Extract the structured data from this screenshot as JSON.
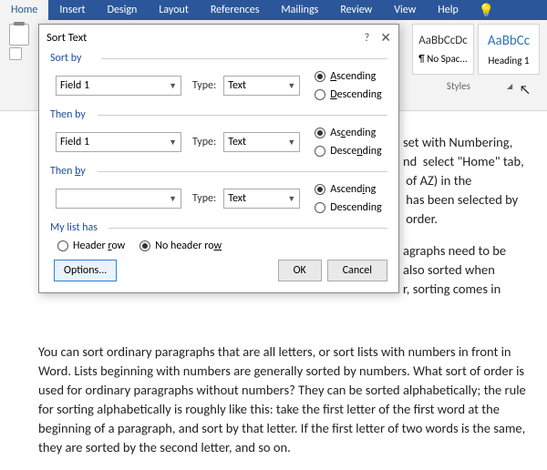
{
  "ribbon": {
    "tabs": [
      "Home",
      "Insert",
      "Design",
      "Layout",
      "References",
      "Mailings",
      "Review",
      "View",
      "Help"
    ],
    "active": "Home"
  },
  "styles": {
    "box1": {
      "preview": "AaBbCcDc",
      "name": "¶ No Spac..."
    },
    "box2": {
      "preview": "AaBbCc",
      "name": "Heading 1"
    },
    "group_label": "Styles"
  },
  "dialog": {
    "title": "Sort Text",
    "sortby_label": "Sort by",
    "thenby_label": "Then by",
    "thenby2_label": "Then by",
    "mylist_label": "My list has",
    "type_label": "Type:",
    "field1": "Field 1",
    "text_type": "Text",
    "asc": "Ascending",
    "desc": "Descending",
    "header_row": "Header row",
    "no_header_row": "No header row",
    "options": "Options...",
    "ok": "OK",
    "cancel": "Cancel"
  },
  "doc": {
    "partial": {
      "l1": "set with Numbering,",
      "l2": "nd  select \"Home\" tab,",
      "l3": " of AZ) in the",
      "l4": " has been selected by",
      "l5": " order.",
      "l6": "agraphs need to be",
      "l7": "also sorted when",
      "l8": "r, sorting comes in"
    },
    "para": "You can sort ordinary paragraphs that are all letters, or sort lists with numbers in front in Word. Lists beginning with numbers are generally sorted by numbers. What sort of order is used for ordinary paragraphs without numbers? They can be sorted alphabetically; the rule for sorting alphabetically is roughly like this: take the first letter of the first word at the beginning of a paragraph, and sort by that letter. If the first letter of two words is the same, they are sorted by the second letter, and so on."
  }
}
